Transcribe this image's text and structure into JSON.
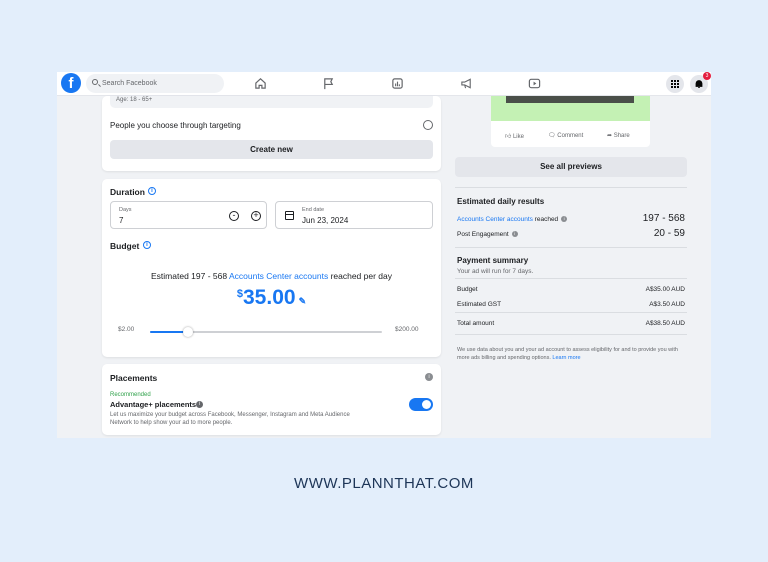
{
  "topbar": {
    "logo_letter": "f",
    "search_placeholder": "Search Facebook",
    "notification_count": "3",
    "nav_icons": [
      "home-icon",
      "flag-icon",
      "ads-manager-icon",
      "megaphone-icon",
      "play-icon"
    ]
  },
  "audience": {
    "age_text": "Age: 18 - 65+",
    "targeting_label": "People you choose through targeting",
    "create_new_label": "Create new"
  },
  "duration": {
    "title": "Duration",
    "days_label": "Days",
    "days_value": "7",
    "end_date_label": "End date",
    "end_date_value": "Jun 23, 2024"
  },
  "budget": {
    "title": "Budget",
    "estimate_prefix": "Estimated 197 - 568 ",
    "estimate_link": "Accounts Center accounts",
    "estimate_suffix": " reached per day",
    "currency_symbol": "$",
    "amount": "35.00",
    "slider_min": "$2.00",
    "slider_max": "$200.00",
    "slider_fraction": 0.165
  },
  "placements": {
    "title": "Placements",
    "recommended": "Recommended",
    "advantage_label": "Advantage+ placements",
    "description": "Let us maximize your budget across Facebook, Messenger, Instagram and Meta Audience Network to help show your ad to more people.",
    "toggle_on": true
  },
  "preview": {
    "like": "Like",
    "comment": "Comment",
    "share": "Share",
    "see_all_label": "See all previews"
  },
  "daily_results": {
    "title": "Estimated daily results",
    "reach_link": "Accounts Center accounts",
    "reach_suffix": " reached",
    "reach_value": "197 - 568",
    "engagement_label": "Post Engagement",
    "engagement_value": "20 - 59"
  },
  "payment": {
    "title": "Payment summary",
    "subtitle": "Your ad will run for 7 days.",
    "rows": [
      {
        "label": "Budget",
        "value": "A$35.00 AUD"
      },
      {
        "label": "Estimated GST",
        "value": "A$3.50 AUD"
      },
      {
        "label": "Total amount",
        "value": "A$38.50 AUD"
      }
    ],
    "disclaimer": "We use data about you and your ad account to assess eligibility for and to provide you with more ads billing and spending options. ",
    "learn_more": "Learn more"
  },
  "footer_url": "WWW.PLANNTHAT.COM",
  "colors": {
    "accent": "#1877f2",
    "recommended": "#31a24c",
    "background": "#e3eefb"
  }
}
